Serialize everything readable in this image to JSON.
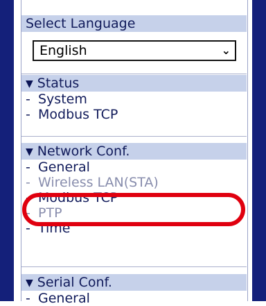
{
  "language": {
    "header": "Select Language",
    "selected": "English",
    "chevron_icon": "chevron-down-icon"
  },
  "status": {
    "header": "Status",
    "items": [
      "System",
      "Modbus TCP"
    ]
  },
  "network_conf": {
    "header": "Network Conf.",
    "items": [
      "General",
      "Wireless LAN(STA)",
      "Modbus TCP",
      "PTP",
      "Time"
    ]
  },
  "serial_conf": {
    "header": "Serial Conf.",
    "items": [
      "General"
    ]
  },
  "colors": {
    "rail": "#14207a",
    "header_bg": "#c6d1ea",
    "highlight": "#e0000f"
  }
}
